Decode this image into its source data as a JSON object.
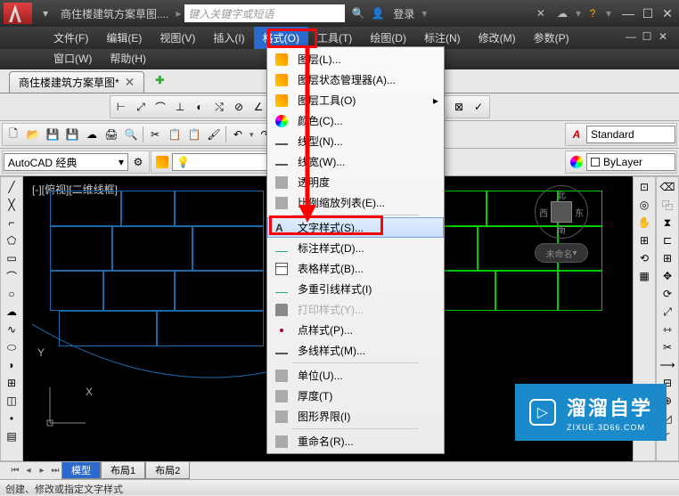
{
  "titlebar": {
    "filename": "商住楼建筑方案草图....",
    "search_placeholder": "键入关键字或短语",
    "login": "登录"
  },
  "menubar": {
    "items": [
      "文件(F)",
      "编辑(E)",
      "视图(V)",
      "插入(I)",
      "格式(O)",
      "工具(T)",
      "绘图(D)",
      "标注(N)",
      "修改(M)",
      "参数(P)"
    ],
    "items2": [
      "窗口(W)",
      "帮助(H)"
    ],
    "active_index": 4
  },
  "tabs": {
    "doc": "商住楼建筑方案草图*"
  },
  "dropdown": {
    "items": [
      {
        "label": "图层(L)...",
        "icon": "layer"
      },
      {
        "label": "图层状态管理器(A)...",
        "icon": "layer"
      },
      {
        "label": "图层工具(O)",
        "icon": "layer",
        "submenu": true
      },
      {
        "label": "颜色(C)...",
        "icon": "color"
      },
      {
        "label": "线型(N)...",
        "icon": "line"
      },
      {
        "label": "线宽(W)...",
        "icon": "line"
      },
      {
        "label": "透明度",
        "icon": "gray"
      },
      {
        "label": "比例缩放列表(E)...",
        "icon": "gray"
      },
      {
        "sep": true
      },
      {
        "label": "文字样式(S)...",
        "icon": "text",
        "highlighted": true
      },
      {
        "label": "标注样式(D)...",
        "icon": "dim"
      },
      {
        "label": "表格样式(B)...",
        "icon": "table"
      },
      {
        "label": "多重引线样式(I)",
        "icon": "dim"
      },
      {
        "label": "打印样式(Y)...",
        "icon": "print",
        "disabled": true
      },
      {
        "label": "点样式(P)...",
        "icon": "point"
      },
      {
        "label": "多线样式(M)...",
        "icon": "line"
      },
      {
        "sep": true
      },
      {
        "label": "单位(U)...",
        "icon": "gray"
      },
      {
        "label": "厚度(T)",
        "icon": "gray"
      },
      {
        "label": "图形界限(I)",
        "icon": "gray"
      },
      {
        "sep": true
      },
      {
        "label": "重命名(R)...",
        "icon": "gray"
      }
    ]
  },
  "workspace": {
    "combo": "AutoCAD 经典",
    "style_label": "Standard",
    "layer_label": "ByLayer",
    "viewport_label": "[-][俯视][二维线框]",
    "nav_label": "未命名",
    "nav_compass": {
      "n": "北",
      "s": "南",
      "e": "东",
      "w": "西"
    }
  },
  "layout_tabs": {
    "items": [
      "模型",
      "布局1",
      "布局2"
    ],
    "active_index": 0
  },
  "status": {
    "text": "创建、修改或指定文字样式"
  },
  "watermark": {
    "brand": "溜溜自学",
    "url": "ZIXUE.3D66.COM"
  },
  "ucs": {
    "x": "X",
    "y": "Y"
  }
}
